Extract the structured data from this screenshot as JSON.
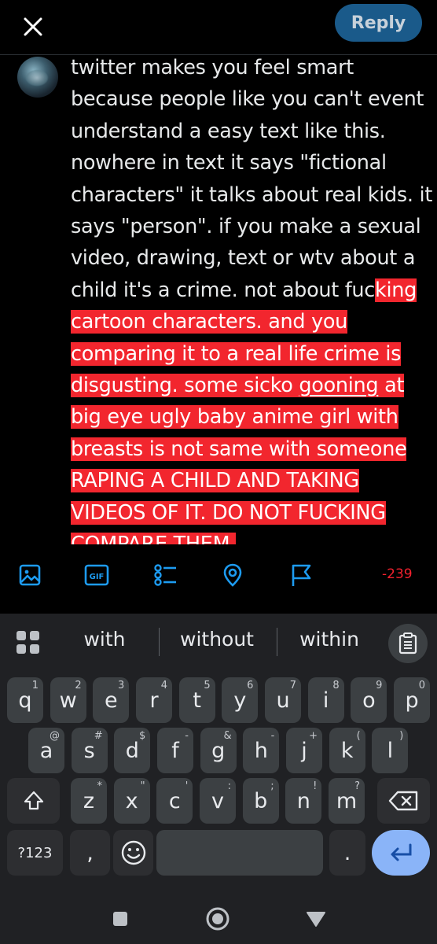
{
  "header": {
    "reply_label": "Reply"
  },
  "compose": {
    "text_normal": "twitter makes you feel smart because people like you can't event understand a easy text like this. nowhere in text it says \"fictional characters\" it talks about real kids. it says \"person\". if you make a sexual video, drawing, text or wtv about a child it's a crime. not about fuc",
    "text_over_1": "king cartoon characters. and you comparing it to a real life crime is disgusting. some sicko ",
    "text_over_underlined": "gooning",
    "text_over_2": " at big eye ugly baby anime girl with breasts is not same with someone RAPING A CHILD AND TAKING VIDEOS OF IT. DO NOT FUCKING COMPARE THEM."
  },
  "toolbar": {
    "counter": "-239",
    "gif_label": "GIF",
    "accent_color": "#1d9bf0",
    "over_color": "#f4212e"
  },
  "keyboard": {
    "suggestions": [
      "with",
      "without",
      "within"
    ],
    "row1": [
      {
        "k": "q",
        "s": "1"
      },
      {
        "k": "w",
        "s": "2"
      },
      {
        "k": "e",
        "s": "3"
      },
      {
        "k": "r",
        "s": "4"
      },
      {
        "k": "t",
        "s": "5"
      },
      {
        "k": "y",
        "s": "6"
      },
      {
        "k": "u",
        "s": "7"
      },
      {
        "k": "i",
        "s": "8"
      },
      {
        "k": "o",
        "s": "9"
      },
      {
        "k": "p",
        "s": "0"
      }
    ],
    "row2": [
      {
        "k": "a",
        "s": "@"
      },
      {
        "k": "s",
        "s": "#"
      },
      {
        "k": "d",
        "s": "$"
      },
      {
        "k": "f",
        "s": "-"
      },
      {
        "k": "g",
        "s": "&"
      },
      {
        "k": "h",
        "s": "-"
      },
      {
        "k": "j",
        "s": "+"
      },
      {
        "k": "k",
        "s": "("
      },
      {
        "k": "l",
        "s": ")"
      }
    ],
    "row3": [
      {
        "k": "z",
        "s": "*"
      },
      {
        "k": "x",
        "s": "\""
      },
      {
        "k": "c",
        "s": "'"
      },
      {
        "k": "v",
        "s": ":"
      },
      {
        "k": "b",
        "s": ";"
      },
      {
        "k": "n",
        "s": "!"
      },
      {
        "k": "m",
        "s": "?"
      }
    ],
    "symbols_label": "?123",
    "comma_label": ",",
    "period_label": "."
  }
}
